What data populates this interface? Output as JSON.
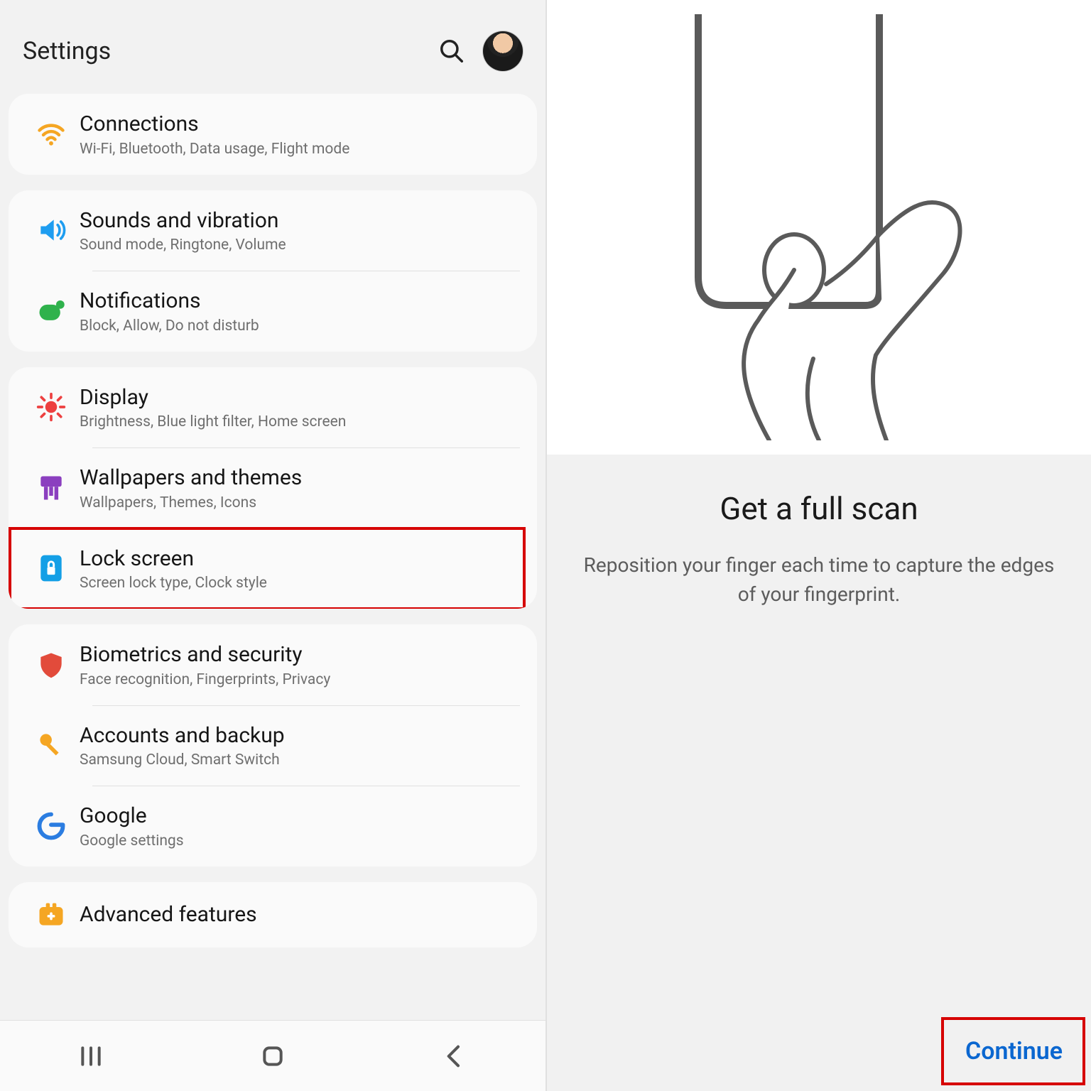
{
  "left": {
    "title": "Settings",
    "groups": [
      {
        "rows": [
          {
            "icon": "wifi",
            "title": "Connections",
            "sub": "Wi-Fi, Bluetooth, Data usage, Flight mode"
          }
        ]
      },
      {
        "rows": [
          {
            "icon": "sound",
            "title": "Sounds and vibration",
            "sub": "Sound mode, Ringtone, Volume"
          },
          {
            "icon": "notifications",
            "title": "Notifications",
            "sub": "Block, Allow, Do not disturb"
          }
        ]
      },
      {
        "rows": [
          {
            "icon": "display",
            "title": "Display",
            "sub": "Brightness, Blue light filter, Home screen"
          },
          {
            "icon": "wallpaper",
            "title": "Wallpapers and themes",
            "sub": "Wallpapers, Themes, Icons"
          },
          {
            "icon": "lock",
            "title": "Lock screen",
            "sub": "Screen lock type, Clock style",
            "highlighted": true
          }
        ]
      },
      {
        "rows": [
          {
            "icon": "security",
            "title": "Biometrics and security",
            "sub": "Face recognition, Fingerprints, Privacy"
          },
          {
            "icon": "accounts",
            "title": "Accounts and backup",
            "sub": "Samsung Cloud, Smart Switch"
          },
          {
            "icon": "google",
            "title": "Google",
            "sub": "Google settings"
          }
        ]
      },
      {
        "rows": [
          {
            "icon": "advanced",
            "title": "Advanced features",
            "sub": ""
          }
        ]
      }
    ]
  },
  "right": {
    "title": "Get a full scan",
    "body": "Reposition your finger each time to capture the edges of your fingerprint.",
    "continue": "Continue"
  },
  "colors": {
    "highlight": "#d60000",
    "link": "#0b67d0"
  }
}
